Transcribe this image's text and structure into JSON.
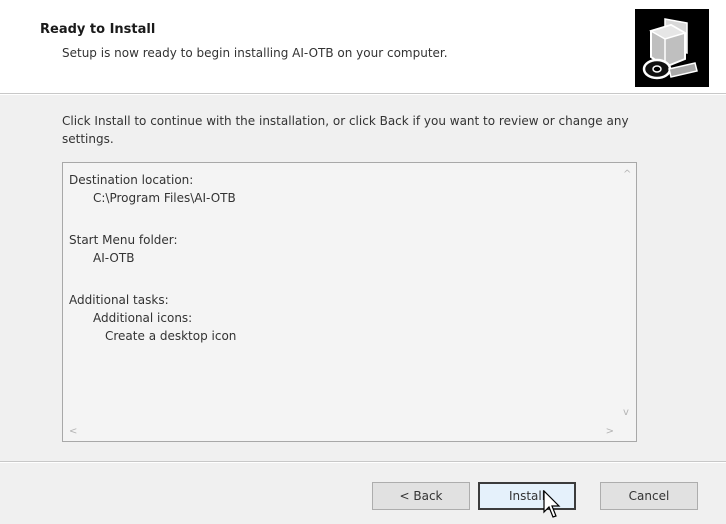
{
  "header": {
    "title": "Ready to Install",
    "subtitle": "Setup is now ready to begin installing AI-OTB on your computer.",
    "image_icon": "computer-install-icon"
  },
  "body": {
    "intro": "Click Install to continue with the installation, or click Back if you want to review or change any settings."
  },
  "memo": {
    "destination_label": "Destination location:",
    "destination_value": "C:\\Program Files\\AI-OTB",
    "start_menu_label": "Start Menu folder:",
    "start_menu_value": "AI-OTB",
    "tasks_label": "Additional tasks:",
    "tasks_group": "Additional icons:",
    "tasks_item": "Create a desktop icon"
  },
  "scrollbars": {
    "up_arrow": "^",
    "down_arrow": "v",
    "left_arrow": "<",
    "right_arrow": ">"
  },
  "buttons": {
    "back": "< Back",
    "install": "Install",
    "cancel": "Cancel"
  },
  "colors": {
    "header_bg": "#ffffff",
    "dialog_bg": "#f0f0f0",
    "memo_bg": "#f4f4f4",
    "default_button_border": "#3c3c3c"
  }
}
